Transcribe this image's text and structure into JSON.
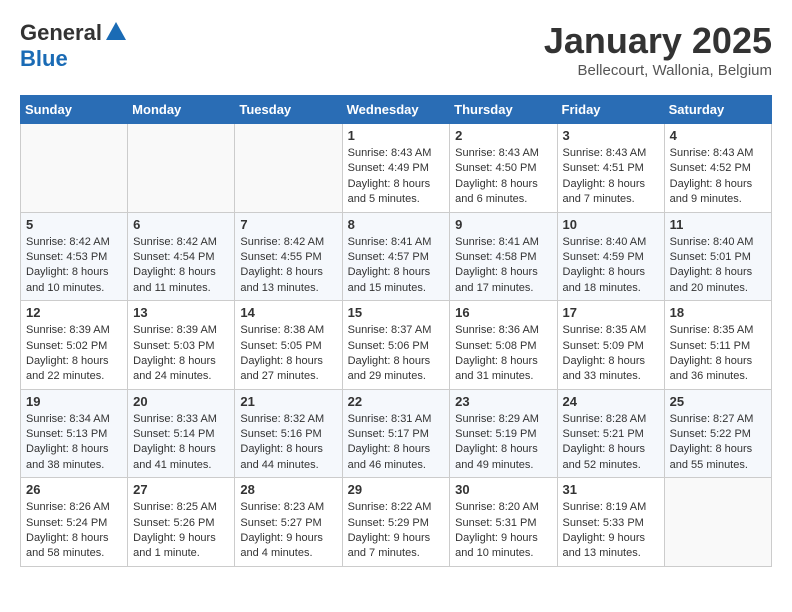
{
  "header": {
    "logo_general": "General",
    "logo_blue": "Blue",
    "month_title": "January 2025",
    "location": "Bellecourt, Wallonia, Belgium"
  },
  "weekdays": [
    "Sunday",
    "Monday",
    "Tuesday",
    "Wednesday",
    "Thursday",
    "Friday",
    "Saturday"
  ],
  "weeks": [
    [
      {
        "day": "",
        "info": ""
      },
      {
        "day": "",
        "info": ""
      },
      {
        "day": "",
        "info": ""
      },
      {
        "day": "1",
        "info": "Sunrise: 8:43 AM\nSunset: 4:49 PM\nDaylight: 8 hours and 5 minutes."
      },
      {
        "day": "2",
        "info": "Sunrise: 8:43 AM\nSunset: 4:50 PM\nDaylight: 8 hours and 6 minutes."
      },
      {
        "day": "3",
        "info": "Sunrise: 8:43 AM\nSunset: 4:51 PM\nDaylight: 8 hours and 7 minutes."
      },
      {
        "day": "4",
        "info": "Sunrise: 8:43 AM\nSunset: 4:52 PM\nDaylight: 8 hours and 9 minutes."
      }
    ],
    [
      {
        "day": "5",
        "info": "Sunrise: 8:42 AM\nSunset: 4:53 PM\nDaylight: 8 hours and 10 minutes."
      },
      {
        "day": "6",
        "info": "Sunrise: 8:42 AM\nSunset: 4:54 PM\nDaylight: 8 hours and 11 minutes."
      },
      {
        "day": "7",
        "info": "Sunrise: 8:42 AM\nSunset: 4:55 PM\nDaylight: 8 hours and 13 minutes."
      },
      {
        "day": "8",
        "info": "Sunrise: 8:41 AM\nSunset: 4:57 PM\nDaylight: 8 hours and 15 minutes."
      },
      {
        "day": "9",
        "info": "Sunrise: 8:41 AM\nSunset: 4:58 PM\nDaylight: 8 hours and 17 minutes."
      },
      {
        "day": "10",
        "info": "Sunrise: 8:40 AM\nSunset: 4:59 PM\nDaylight: 8 hours and 18 minutes."
      },
      {
        "day": "11",
        "info": "Sunrise: 8:40 AM\nSunset: 5:01 PM\nDaylight: 8 hours and 20 minutes."
      }
    ],
    [
      {
        "day": "12",
        "info": "Sunrise: 8:39 AM\nSunset: 5:02 PM\nDaylight: 8 hours and 22 minutes."
      },
      {
        "day": "13",
        "info": "Sunrise: 8:39 AM\nSunset: 5:03 PM\nDaylight: 8 hours and 24 minutes."
      },
      {
        "day": "14",
        "info": "Sunrise: 8:38 AM\nSunset: 5:05 PM\nDaylight: 8 hours and 27 minutes."
      },
      {
        "day": "15",
        "info": "Sunrise: 8:37 AM\nSunset: 5:06 PM\nDaylight: 8 hours and 29 minutes."
      },
      {
        "day": "16",
        "info": "Sunrise: 8:36 AM\nSunset: 5:08 PM\nDaylight: 8 hours and 31 minutes."
      },
      {
        "day": "17",
        "info": "Sunrise: 8:35 AM\nSunset: 5:09 PM\nDaylight: 8 hours and 33 minutes."
      },
      {
        "day": "18",
        "info": "Sunrise: 8:35 AM\nSunset: 5:11 PM\nDaylight: 8 hours and 36 minutes."
      }
    ],
    [
      {
        "day": "19",
        "info": "Sunrise: 8:34 AM\nSunset: 5:13 PM\nDaylight: 8 hours and 38 minutes."
      },
      {
        "day": "20",
        "info": "Sunrise: 8:33 AM\nSunset: 5:14 PM\nDaylight: 8 hours and 41 minutes."
      },
      {
        "day": "21",
        "info": "Sunrise: 8:32 AM\nSunset: 5:16 PM\nDaylight: 8 hours and 44 minutes."
      },
      {
        "day": "22",
        "info": "Sunrise: 8:31 AM\nSunset: 5:17 PM\nDaylight: 8 hours and 46 minutes."
      },
      {
        "day": "23",
        "info": "Sunrise: 8:29 AM\nSunset: 5:19 PM\nDaylight: 8 hours and 49 minutes."
      },
      {
        "day": "24",
        "info": "Sunrise: 8:28 AM\nSunset: 5:21 PM\nDaylight: 8 hours and 52 minutes."
      },
      {
        "day": "25",
        "info": "Sunrise: 8:27 AM\nSunset: 5:22 PM\nDaylight: 8 hours and 55 minutes."
      }
    ],
    [
      {
        "day": "26",
        "info": "Sunrise: 8:26 AM\nSunset: 5:24 PM\nDaylight: 8 hours and 58 minutes."
      },
      {
        "day": "27",
        "info": "Sunrise: 8:25 AM\nSunset: 5:26 PM\nDaylight: 9 hours and 1 minute."
      },
      {
        "day": "28",
        "info": "Sunrise: 8:23 AM\nSunset: 5:27 PM\nDaylight: 9 hours and 4 minutes."
      },
      {
        "day": "29",
        "info": "Sunrise: 8:22 AM\nSunset: 5:29 PM\nDaylight: 9 hours and 7 minutes."
      },
      {
        "day": "30",
        "info": "Sunrise: 8:20 AM\nSunset: 5:31 PM\nDaylight: 9 hours and 10 minutes."
      },
      {
        "day": "31",
        "info": "Sunrise: 8:19 AM\nSunset: 5:33 PM\nDaylight: 9 hours and 13 minutes."
      },
      {
        "day": "",
        "info": ""
      }
    ]
  ]
}
